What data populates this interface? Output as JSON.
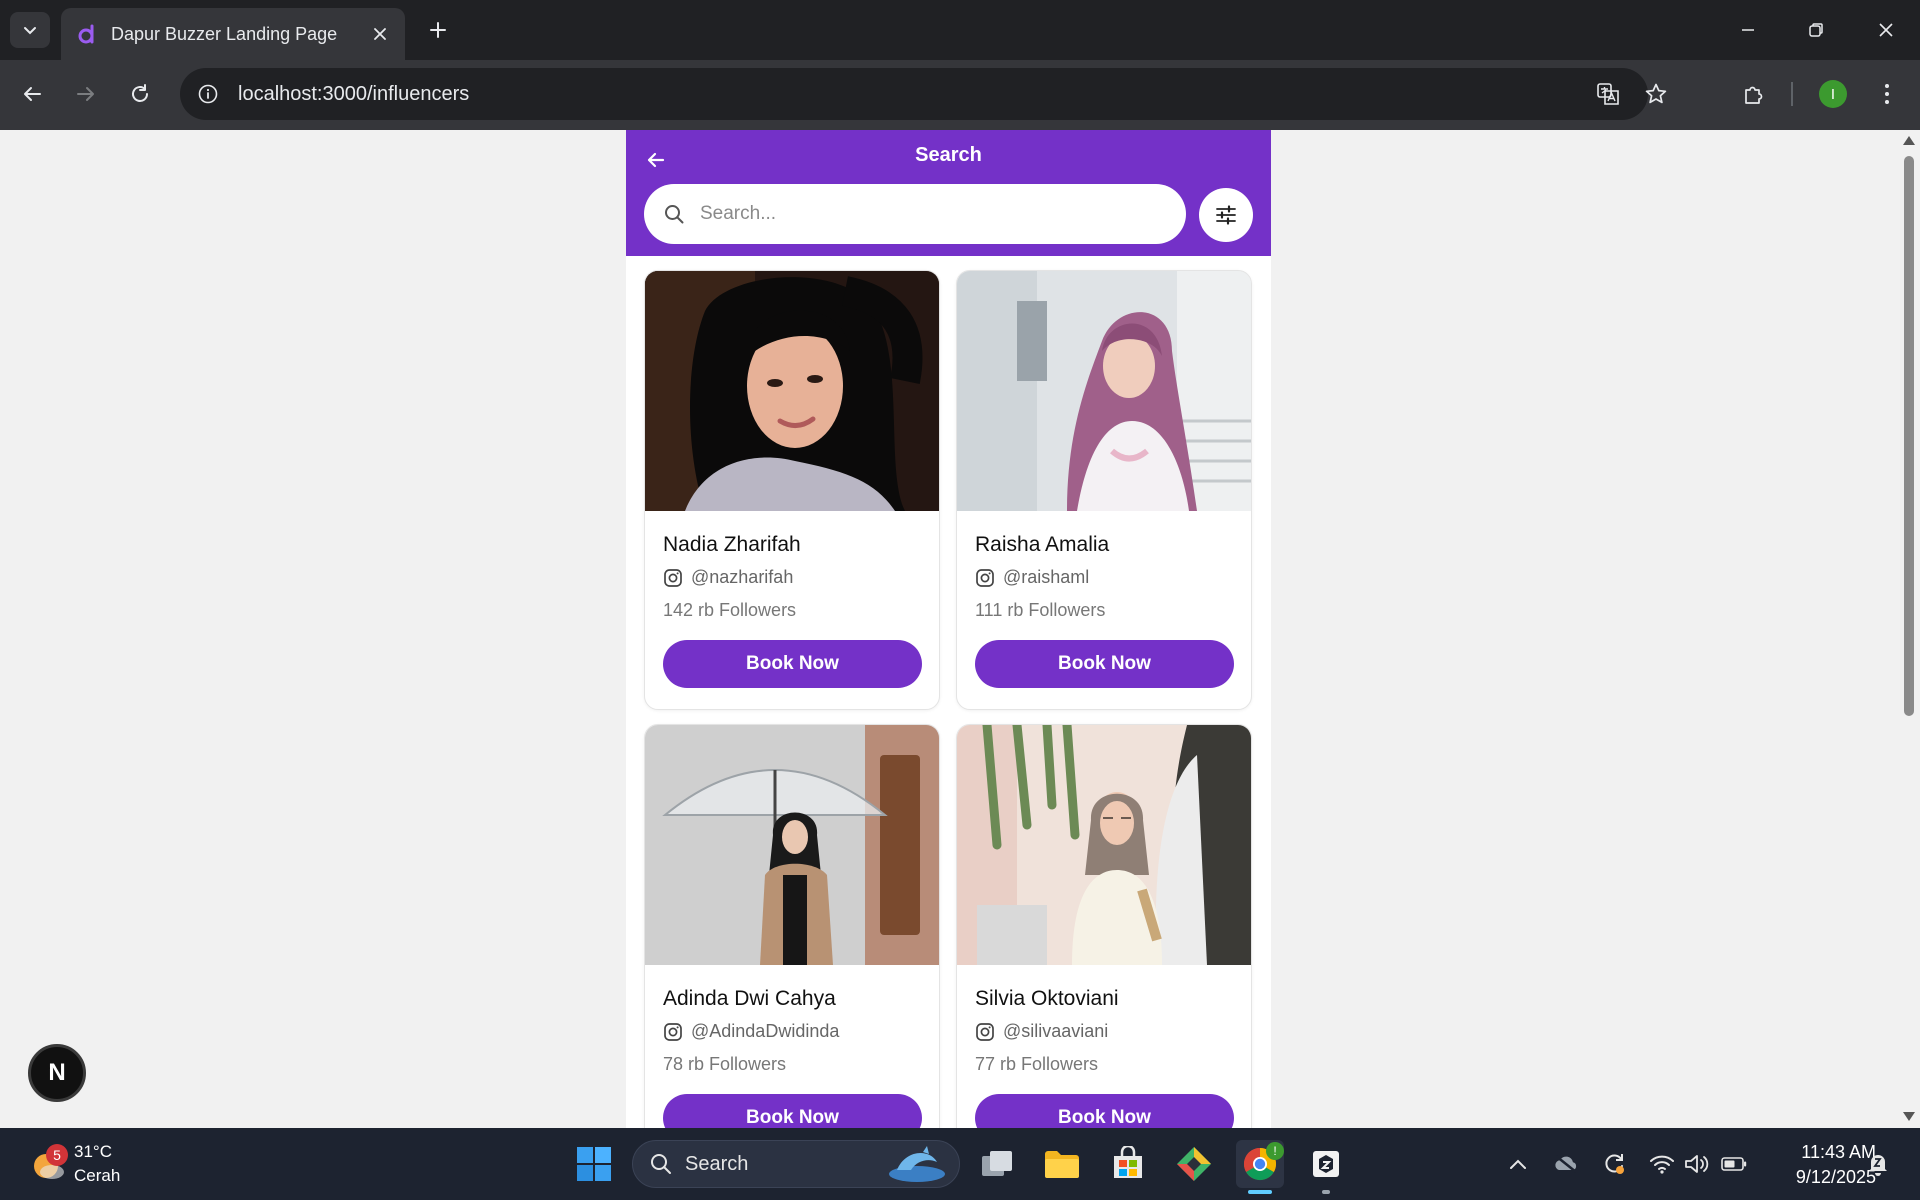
{
  "browser": {
    "tab_title": "Dapur Buzzer Landing Page",
    "url": "localhost:3000/influencers",
    "profile_initial": "I"
  },
  "app": {
    "header_title": "Search",
    "search_placeholder": "Search...",
    "accent_color": "#7431c8",
    "influencers": [
      {
        "name": "Nadia Zharifah",
        "handle": "@nazharifah",
        "followers": "142 rb Followers",
        "cta": "Book Now"
      },
      {
        "name": "Raisha Amalia",
        "handle": "@raishaml",
        "followers": "111 rb Followers",
        "cta": "Book Now"
      },
      {
        "name": "Adinda Dwi Cahya",
        "handle": "@AdindaDwidinda",
        "followers": "78 rb Followers",
        "cta": "Book Now"
      },
      {
        "name": "Silvia Oktoviani",
        "handle": "@silivaaviani",
        "followers": "77 rb Followers",
        "cta": "Book Now"
      }
    ],
    "next_badge": "N"
  },
  "taskbar": {
    "weather_temp": "31°C",
    "weather_desc": "Cerah",
    "weather_badge": "5",
    "search_label": "Search",
    "chrome_badge": "!",
    "time": "11:43 AM",
    "date": "9/12/2025"
  }
}
